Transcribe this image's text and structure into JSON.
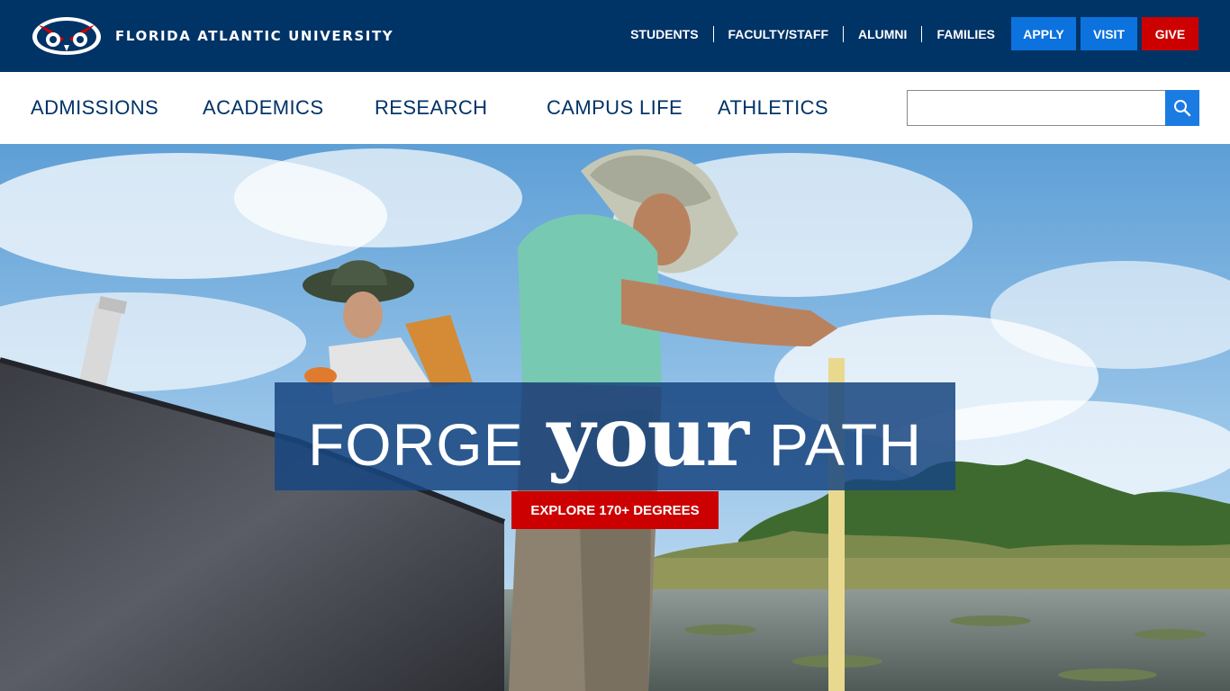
{
  "brand": {
    "name": "FLORIDA ATLANTIC UNIVERSITY",
    "logo_icon": "owl-logo-icon"
  },
  "audience_nav": [
    {
      "label": "STUDENTS"
    },
    {
      "label": "FACULTY/STAFF"
    },
    {
      "label": "ALUMNI"
    },
    {
      "label": "FAMILIES"
    }
  ],
  "cta": {
    "apply": "APPLY",
    "visit": "VISIT",
    "give": "GIVE"
  },
  "main_nav": [
    {
      "label": "ADMISSIONS"
    },
    {
      "label": "ACADEMICS"
    },
    {
      "label": "RESEARCH"
    },
    {
      "label": "CAMPUS LIFE"
    },
    {
      "label": "ATHLETICS"
    }
  ],
  "search": {
    "value": "",
    "placeholder": "",
    "icon": "search-icon"
  },
  "hero": {
    "headline_1": "FORGE",
    "headline_2": "your",
    "headline_3": "PATH",
    "button": "EXPLORE 170+ DEGREES"
  },
  "colors": {
    "topbar_bg": "#003366",
    "nav_text": "#003366",
    "apply_visit": "#0c72dd",
    "give": "#cc0000",
    "explore": "#cc0000",
    "headline_box": "#184680"
  }
}
